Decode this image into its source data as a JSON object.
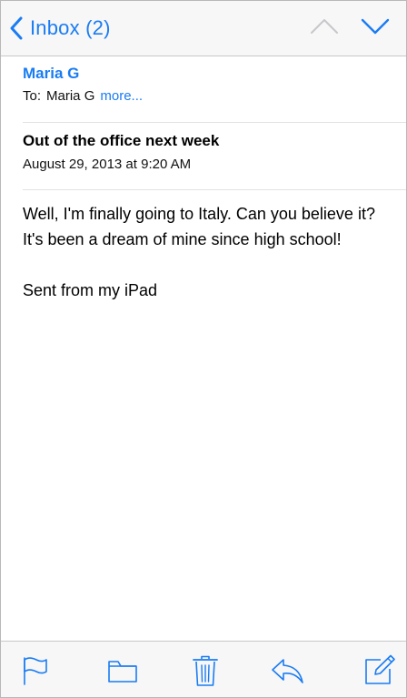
{
  "nav": {
    "back_label": "Inbox (2)",
    "icons": {
      "back": "chevron-left-icon",
      "previous": "chevron-up-icon",
      "next": "chevron-down-icon"
    }
  },
  "message": {
    "from": "Maria G",
    "to_label": "To:",
    "to_value": "Maria G",
    "more_label": "more...",
    "subject": "Out of the office next week",
    "date": "August 29, 2013 at 9:20 AM",
    "body": {
      "line1": "Well, I'm finally going to Italy. Can you believe it?",
      "line2": "It's been a dream of mine since high school!",
      "signature": "Sent from my iPad"
    }
  },
  "toolbar": {
    "icons": [
      "flag-icon",
      "folder-icon",
      "trash-icon",
      "reply-icon",
      "compose-icon"
    ]
  },
  "colors": {
    "accent": "#1a7cf3",
    "disabled": "#c7c7cc",
    "bar_background": "#f7f7f7"
  }
}
